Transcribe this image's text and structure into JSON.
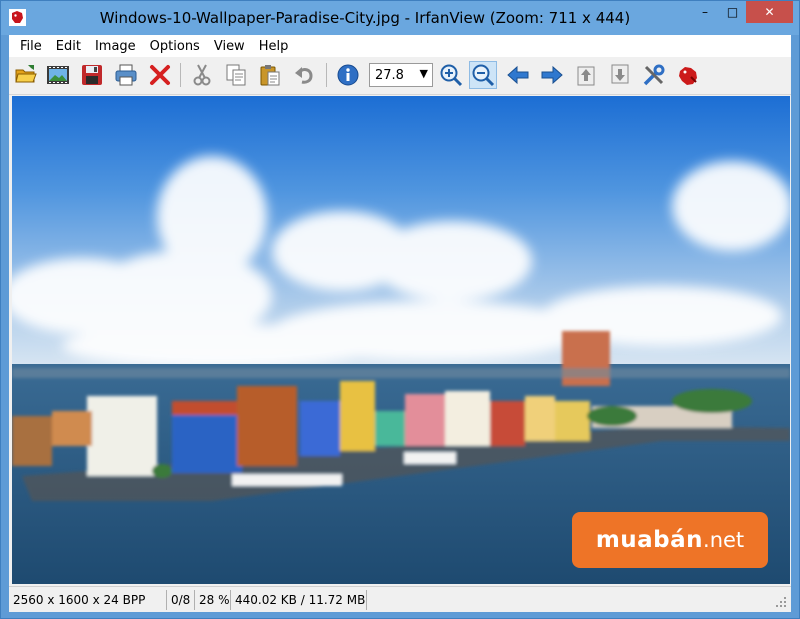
{
  "window": {
    "title": "Windows-10-Wallpaper-Paradise-City.jpg - IrfanView (Zoom: 711 x 444)",
    "controls": {
      "minimize": "–",
      "maximize": "□",
      "close": "✕"
    }
  },
  "menu": [
    "File",
    "Edit",
    "Image",
    "Options",
    "View",
    "Help"
  ],
  "toolbar": {
    "buttons": [
      {
        "name": "open-icon",
        "label": "Open"
      },
      {
        "name": "slideshow-icon",
        "label": "Slideshow"
      },
      {
        "name": "save-icon",
        "label": "Save"
      },
      {
        "name": "print-icon",
        "label": "Print"
      },
      {
        "name": "delete-icon",
        "label": "Delete"
      },
      {
        "name": "cut-icon",
        "label": "Cut"
      },
      {
        "name": "copy-icon",
        "label": "Copy"
      },
      {
        "name": "paste-icon",
        "label": "Paste"
      },
      {
        "name": "undo-icon",
        "label": "Undo"
      },
      {
        "name": "info-icon",
        "label": "Info"
      },
      {
        "name": "zoom-in-icon",
        "label": "Zoom in"
      },
      {
        "name": "zoom-out-icon",
        "label": "Zoom out"
      },
      {
        "name": "previous-icon",
        "label": "Previous"
      },
      {
        "name": "next-icon",
        "label": "Next"
      },
      {
        "name": "first-page-icon",
        "label": "First page"
      },
      {
        "name": "last-page-icon",
        "label": "Last page"
      },
      {
        "name": "settings-icon",
        "label": "Properties"
      },
      {
        "name": "irfanview-logo-icon",
        "label": "About"
      }
    ],
    "zoom_value": "27.8"
  },
  "watermark": {
    "text_main": "muabán",
    "text_suffix": ".net"
  },
  "status": {
    "dimensions": "2560 x 1600 x 24 BPP",
    "index": "0/8",
    "zoom": "28 %",
    "size": "440.02 KB / 11.72 MB"
  },
  "colors": {
    "titlebar": "#6aa7df",
    "close_button": "#c7504b",
    "watermark": "#ee7427"
  }
}
